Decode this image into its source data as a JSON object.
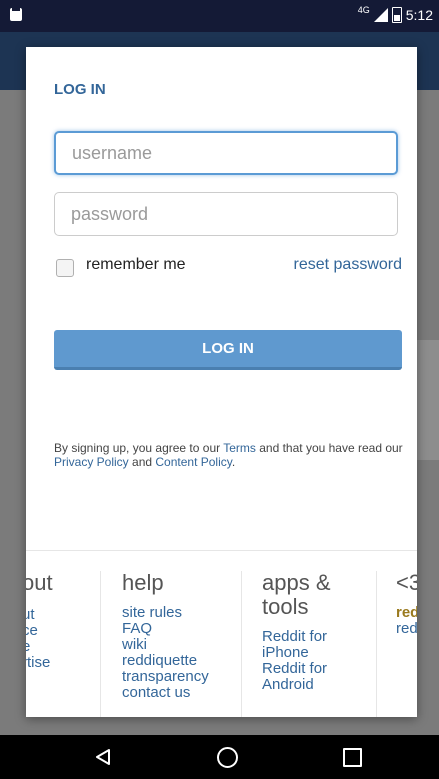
{
  "status_bar": {
    "network": "4G",
    "time": "5:12"
  },
  "login": {
    "title": "LOG IN",
    "username_placeholder": "username",
    "password_placeholder": "password",
    "remember_label": "remember me",
    "reset_label": "reset password",
    "submit_label": "LOG IN",
    "terms_prefix": "By signing up, you agree to our ",
    "terms_link": "Terms",
    "terms_mid": " and that you have read our ",
    "privacy_link": "Privacy Policy",
    "terms_and": " and ",
    "content_link": "Content Policy",
    "terms_end": "."
  },
  "footer": {
    "about": {
      "title": "out",
      "links": [
        "ut",
        "ce",
        "e",
        "rtise"
      ]
    },
    "help": {
      "title": "help",
      "links": [
        "site rules",
        "FAQ",
        "wiki",
        "reddiquette",
        "transparency",
        "contact us"
      ]
    },
    "apps": {
      "title_line1": "apps &",
      "title_line2": "tools",
      "links": [
        "Reddit for iPhone",
        "Reddit for Android"
      ]
    },
    "love": {
      "title": "<3",
      "links": [
        "reddi",
        "reddi"
      ]
    }
  }
}
